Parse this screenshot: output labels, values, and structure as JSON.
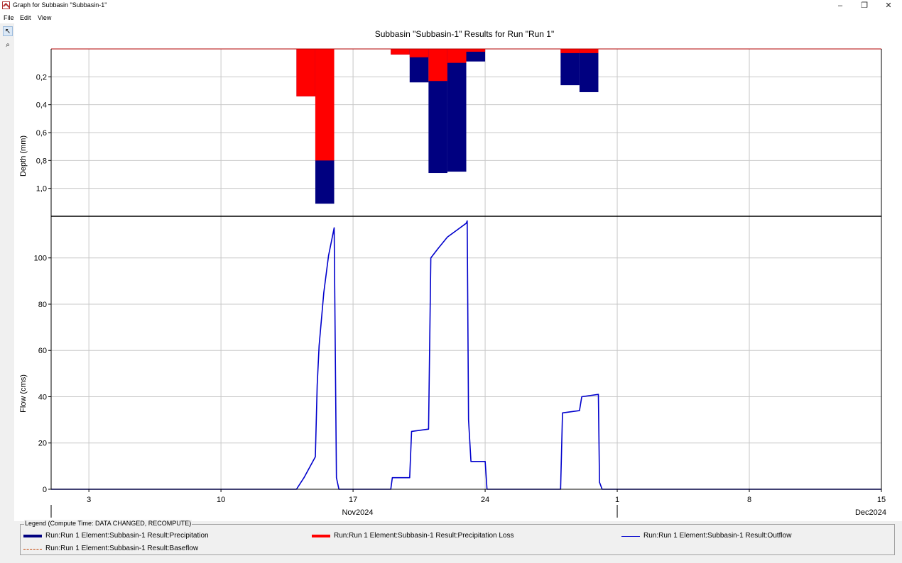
{
  "window": {
    "title": "Graph for Subbasin \"Subbasin-1\"",
    "minimize_glyph": "–",
    "restore_glyph": "❐",
    "close_glyph": "✕"
  },
  "menu": [
    "File",
    "Edit",
    "View"
  ],
  "tools": [
    {
      "name": "pointer-icon",
      "glyph": "↖"
    },
    {
      "name": "zoom-icon",
      "glyph": "⌕"
    }
  ],
  "chart_data": {
    "title": "Subbasin \"Subbasin-1\" Results for Run \"Run 1\"",
    "x_axis": {
      "range": [
        "2024-11-01",
        "2024-12-15"
      ],
      "tick_labels": [
        "3",
        "10",
        "17",
        "24",
        "1",
        "8",
        "15"
      ],
      "ticks": [
        "2024-11-03",
        "2024-11-10",
        "2024-11-17",
        "2024-11-24",
        "2024-12-01",
        "2024-12-08",
        "2024-12-15"
      ],
      "month_labels": [
        "Nov2024",
        "Dec2024"
      ],
      "month_boundary": "2024-12-01"
    },
    "depth_panel": {
      "type": "bar",
      "ylabel": "Depth (mm)",
      "inverted": true,
      "ylim": [
        0,
        1.2
      ],
      "tick_labels": [
        "0,2",
        "0,4",
        "0,6",
        "0,8",
        "1,0"
      ],
      "ticks": [
        0.2,
        0.4,
        0.6,
        0.8,
        1.0
      ],
      "bars": [
        {
          "start": "2024-11-14",
          "end": "2024-11-15",
          "precipitation": 0.34,
          "loss": 0.34
        },
        {
          "start": "2024-11-15",
          "end": "2024-11-16",
          "precipitation": 1.11,
          "loss": 0.8
        },
        {
          "start": "2024-11-19",
          "end": "2024-11-20",
          "precipitation": 0.04,
          "loss": 0.04
        },
        {
          "start": "2024-11-20",
          "end": "2024-11-21",
          "precipitation": 0.24,
          "loss": 0.06
        },
        {
          "start": "2024-11-21",
          "end": "2024-11-22",
          "precipitation": 0.89,
          "loss": 0.23
        },
        {
          "start": "2024-11-22",
          "end": "2024-11-23",
          "precipitation": 0.88,
          "loss": 0.1
        },
        {
          "start": "2024-11-23",
          "end": "2024-11-24",
          "precipitation": 0.09,
          "loss": 0.02
        },
        {
          "start": "2024-11-28",
          "end": "2024-11-29",
          "precipitation": 0.26,
          "loss": 0.03
        },
        {
          "start": "2024-11-29",
          "end": "2024-11-30",
          "precipitation": 0.31,
          "loss": 0.03
        }
      ]
    },
    "flow_panel": {
      "type": "line",
      "ylabel": "Flow (cms)",
      "ylim": [
        0,
        118
      ],
      "tick_labels": [
        "0",
        "20",
        "40",
        "60",
        "80",
        "100"
      ],
      "ticks": [
        0,
        20,
        40,
        60,
        80,
        100
      ],
      "outflow": [
        [
          "2024-11-01",
          0
        ],
        [
          "2024-11-14",
          0
        ],
        [
          "2024-11-14.4",
          5
        ],
        [
          "2024-11-15",
          14
        ],
        [
          "2024-11-15.1",
          45
        ],
        [
          "2024-11-15.2",
          62
        ],
        [
          "2024-11-15.45",
          85
        ],
        [
          "2024-11-15.7",
          101
        ],
        [
          "2024-11-16",
          113
        ],
        [
          "2024-11-16.12",
          5
        ],
        [
          "2024-11-16.25",
          0
        ],
        [
          "2024-11-19",
          0
        ],
        [
          "2024-11-19.08",
          5
        ],
        [
          "2024-11-20",
          5
        ],
        [
          "2024-11-20.1",
          25
        ],
        [
          "2024-11-21",
          26
        ],
        [
          "2024-11-21.12",
          100
        ],
        [
          "2024-11-21.5",
          104
        ],
        [
          "2024-11-22",
          109
        ],
        [
          "2024-11-22.5",
          112
        ],
        [
          "2024-11-23",
          115
        ],
        [
          "2024-11-23.05",
          116
        ],
        [
          "2024-11-23.12",
          30
        ],
        [
          "2024-11-23.25",
          12
        ],
        [
          "2024-11-24",
          12
        ],
        [
          "2024-11-24.1",
          0
        ],
        [
          "2024-11-28",
          0
        ],
        [
          "2024-11-28.1",
          33
        ],
        [
          "2024-11-29",
          34
        ],
        [
          "2024-11-29.12",
          40
        ],
        [
          "2024-11-30",
          41
        ],
        [
          "2024-11-30.06",
          3
        ],
        [
          "2024-11-30.2",
          0
        ],
        [
          "2024-12-15",
          0
        ]
      ],
      "baseflow": [
        [
          "2024-11-01",
          0
        ],
        [
          "2024-12-15",
          0
        ]
      ]
    },
    "colors": {
      "precipitation": "#000080",
      "loss": "#ff0000",
      "outflow": "#0000cc",
      "baseflow": "#c04000",
      "grid": "#c8c8c8"
    },
    "legend": {
      "caption": "Legend (Compute Time: DATA CHANGED, RECOMPUTE)",
      "entries": [
        {
          "label": "Run:Run 1 Element:Subbasin-1 Result:Precipitation",
          "style": "thick",
          "color": "#000080"
        },
        {
          "label": "Run:Run 1 Element:Subbasin-1 Result:Precipitation Loss",
          "style": "thick",
          "color": "#ff0000"
        },
        {
          "label": "Run:Run 1 Element:Subbasin-1 Result:Outflow",
          "style": "thin",
          "color": "#0000cc"
        },
        {
          "label": "Run:Run 1 Element:Subbasin-1 Result:Baseflow",
          "style": "dashed",
          "color": "#c04000"
        }
      ]
    }
  }
}
